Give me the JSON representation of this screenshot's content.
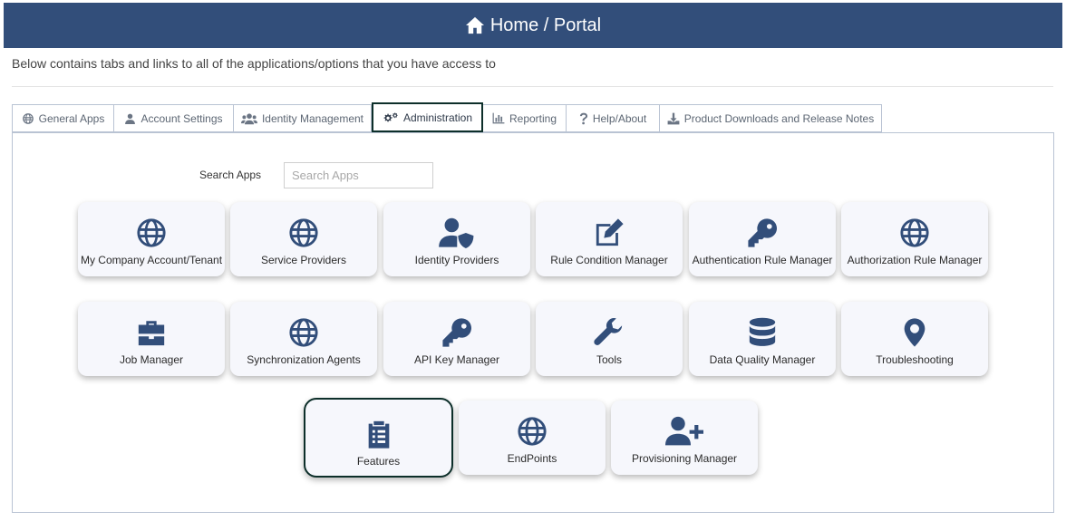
{
  "header": {
    "title": "Home / Portal",
    "icon": "home-icon"
  },
  "intro": "Below contains tabs and links to all of the applications/options that you have access to",
  "tabs": [
    {
      "label": "General Apps",
      "icon": "globe-icon",
      "active": false
    },
    {
      "label": "Account Settings",
      "icon": "user-icon",
      "active": false
    },
    {
      "label": "Identity Management",
      "icon": "users-icon",
      "active": false
    },
    {
      "label": "Administration",
      "icon": "gears-icon",
      "active": true
    },
    {
      "label": "Reporting",
      "icon": "chart-icon",
      "active": false
    },
    {
      "label": "Help/About",
      "icon": "question-icon",
      "active": false
    },
    {
      "label": "Product Downloads and Release Notes",
      "icon": "download-icon",
      "active": false
    }
  ],
  "search": {
    "label": "Search Apps",
    "placeholder": "Search Apps"
  },
  "apps": [
    {
      "label": "My Company Account/Tenant",
      "icon": "globe-icon"
    },
    {
      "label": "Service Providers",
      "icon": "globe-icon"
    },
    {
      "label": "Identity Providers",
      "icon": "user-shield-icon"
    },
    {
      "label": "Rule Condition Manager",
      "icon": "edit-icon"
    },
    {
      "label": "Authentication Rule Manager",
      "icon": "key-icon"
    },
    {
      "label": "Authorization Rule Manager",
      "icon": "globe-icon"
    },
    {
      "label": "Job Manager",
      "icon": "briefcase-icon"
    },
    {
      "label": "Synchronization Agents",
      "icon": "globe-icon"
    },
    {
      "label": "API Key Manager",
      "icon": "key-icon"
    },
    {
      "label": "Tools",
      "icon": "wrench-icon"
    },
    {
      "label": "Data Quality Manager",
      "icon": "database-icon"
    },
    {
      "label": "Troubleshooting",
      "icon": "map-marker-icon"
    },
    {
      "label": "Features",
      "icon": "clipboard-list-icon"
    },
    {
      "label": "EndPoints",
      "icon": "globe-icon"
    },
    {
      "label": "Provisioning Manager",
      "icon": "user-plus-icon"
    }
  ],
  "colors": {
    "header_bg": "#324e7a",
    "icon": "#324e7a",
    "focus_border": "#0d2f2a"
  }
}
